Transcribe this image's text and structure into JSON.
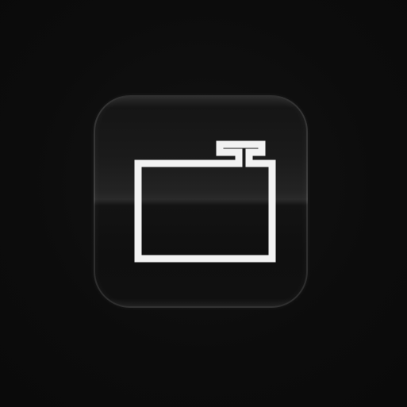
{
  "app_tile": {
    "icon": "suitcase-icon",
    "accent_color": "#f2f2f2",
    "tile_border_color": "#3a3a3a",
    "background_color": "#0d0d0d"
  }
}
